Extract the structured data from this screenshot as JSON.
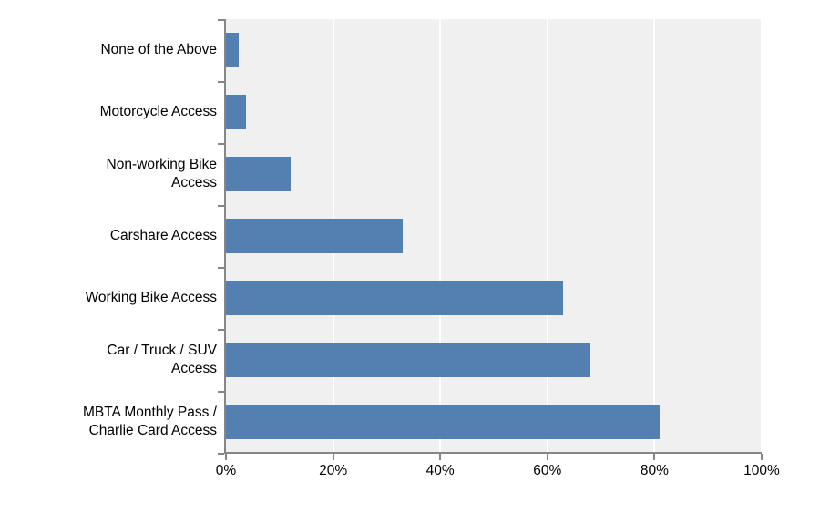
{
  "chart_data": {
    "type": "bar",
    "orientation": "horizontal",
    "title": "",
    "subtitle": "",
    "xlabel": "",
    "ylabel": "",
    "categories": [
      "MBTA Monthly Pass /\nCharlie Card Access",
      "Car / Truck / SUV\nAccess",
      "Working Bike Access",
      "Carshare Access",
      "Non-working Bike\nAccess",
      "Motorcycle Access",
      "None of the Above"
    ],
    "values": [
      81,
      68,
      63,
      33,
      12,
      3.7,
      2.4
    ],
    "value_unit": "%",
    "xlim": [
      0,
      100
    ],
    "xticks": [
      0,
      20,
      40,
      60,
      80,
      100
    ],
    "xtick_labels": [
      "0%",
      "20%",
      "40%",
      "60%",
      "80%",
      "100%"
    ],
    "grid": "vertical",
    "legend": "none",
    "bar_color": "#5380B0",
    "plot_background": "#F0F0F0",
    "gridline_color": "#FFFFFF",
    "axis_color": "#868686",
    "text_color": "#000000",
    "page_background": "#FFFFFF"
  }
}
